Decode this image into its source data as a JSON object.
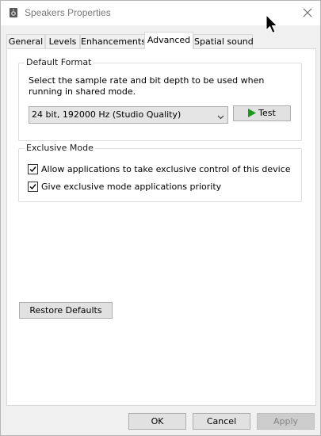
{
  "window": {
    "title": "Speakers Properties"
  },
  "tabs": [
    {
      "label": "General"
    },
    {
      "label": "Levels"
    },
    {
      "label": "Enhancements"
    },
    {
      "label": "Advanced"
    },
    {
      "label": "Spatial sound"
    }
  ],
  "active_tab": "Advanced",
  "default_format": {
    "group_label": "Default Format",
    "description": "Select the sample rate and bit depth to be used when running in shared mode.",
    "selected_format": "24 bit, 192000 Hz (Studio Quality)",
    "test_label": "Test"
  },
  "exclusive_mode": {
    "group_label": "Exclusive Mode",
    "options": [
      {
        "label": "Allow applications to take exclusive control of this device",
        "checked": true
      },
      {
        "label": "Give exclusive mode applications priority",
        "checked": true
      }
    ]
  },
  "restore_label": "Restore Defaults",
  "footer": {
    "ok_label": "OK",
    "cancel_label": "Cancel",
    "apply_label": "Apply"
  },
  "colors": {
    "accent_play": "#1a9a1a",
    "disabled_text": "#838383"
  }
}
